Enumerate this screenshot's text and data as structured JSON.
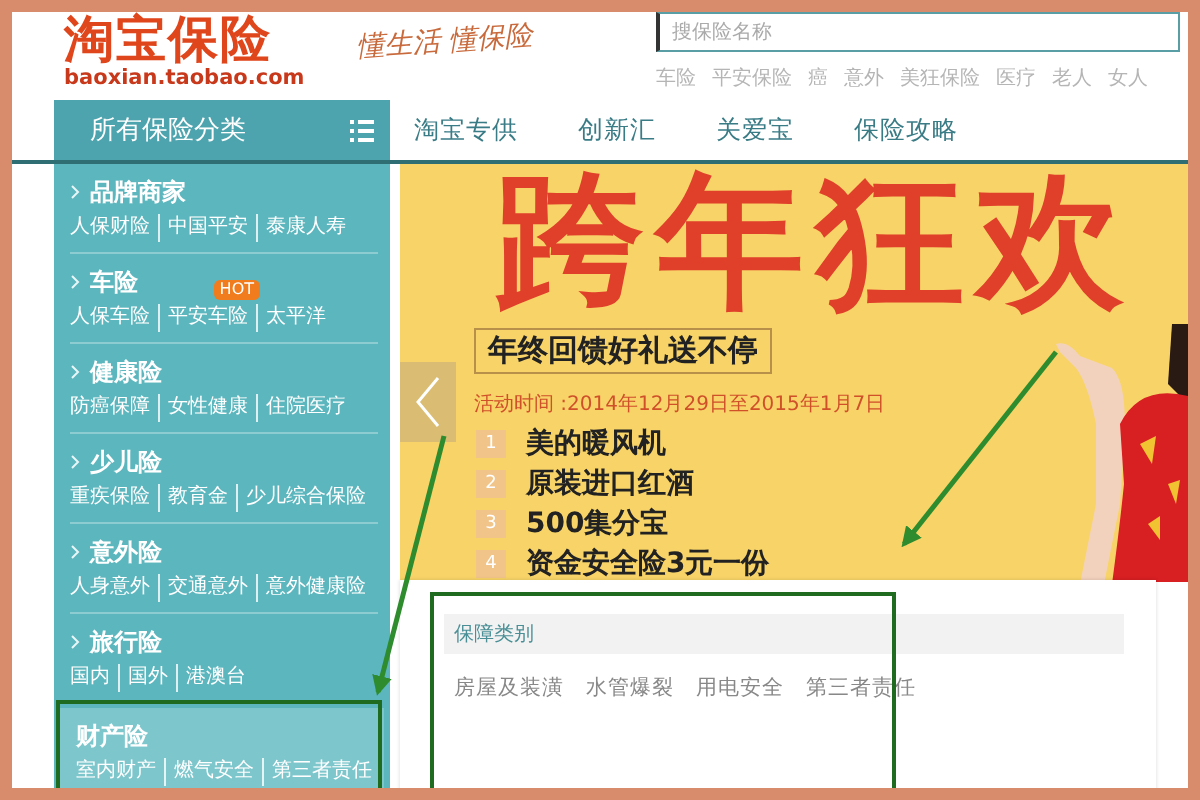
{
  "logo": {
    "title": "淘宝保险",
    "domain": "baoxian.taobao.com",
    "slogan": "懂生活 懂保险"
  },
  "search": {
    "placeholder": "搜保险名称",
    "hot_words": [
      "车险",
      "平安保险",
      "癌",
      "意外",
      "美狂保险",
      "医疗",
      "老人",
      "女人"
    ]
  },
  "category_header": "所有保险分类",
  "nav_tabs": [
    {
      "label": "淘宝专供"
    },
    {
      "label": "创新汇"
    },
    {
      "label": "关爱宝"
    },
    {
      "label": "保险攻略"
    }
  ],
  "categories": [
    {
      "title": "品牌商家",
      "selected": false,
      "items": [
        {
          "label": "人保财险"
        },
        {
          "label": "中国平安"
        },
        {
          "label": "泰康人寿"
        }
      ]
    },
    {
      "title": "车险",
      "selected": false,
      "items": [
        {
          "label": "人保车险"
        },
        {
          "label": "平安车险",
          "badge": "HOT"
        },
        {
          "label": "太平洋"
        }
      ]
    },
    {
      "title": "健康险",
      "selected": false,
      "items": [
        {
          "label": "防癌保障"
        },
        {
          "label": "女性健康"
        },
        {
          "label": "住院医疗"
        }
      ]
    },
    {
      "title": "少儿险",
      "selected": false,
      "items": [
        {
          "label": "重疾保险"
        },
        {
          "label": "教育金"
        },
        {
          "label": "少儿综合保险"
        }
      ]
    },
    {
      "title": "意外险",
      "selected": false,
      "items": [
        {
          "label": "人身意外"
        },
        {
          "label": "交通意外"
        },
        {
          "label": "意外健康险"
        }
      ]
    },
    {
      "title": "旅行险",
      "selected": false,
      "items": [
        {
          "label": "国内"
        },
        {
          "label": "国外"
        },
        {
          "label": "港澳台"
        }
      ]
    },
    {
      "title": "财产险",
      "selected": true,
      "items": [
        {
          "label": "室内财产"
        },
        {
          "label": "燃气安全"
        },
        {
          "label": "第三者责任"
        }
      ]
    }
  ],
  "banner": {
    "headline": "跨年狂欢",
    "tagline": "年终回馈好礼送不停",
    "period": "活动时间 :2014年12月29日至2015年1月7日",
    "prizes": [
      {
        "number": "1",
        "text": "美的暖风机"
      },
      {
        "number": "2",
        "text": "原装进口红酒"
      },
      {
        "number": "3",
        "text": "500集分宝"
      },
      {
        "number": "4",
        "text": "资金安全险3元一份"
      }
    ]
  },
  "popup": {
    "sections": [
      {
        "title": "保障类别",
        "items": [
          "房屋及装潢",
          "水管爆裂",
          "用电安全",
          "第三者责任"
        ]
      }
    ]
  }
}
